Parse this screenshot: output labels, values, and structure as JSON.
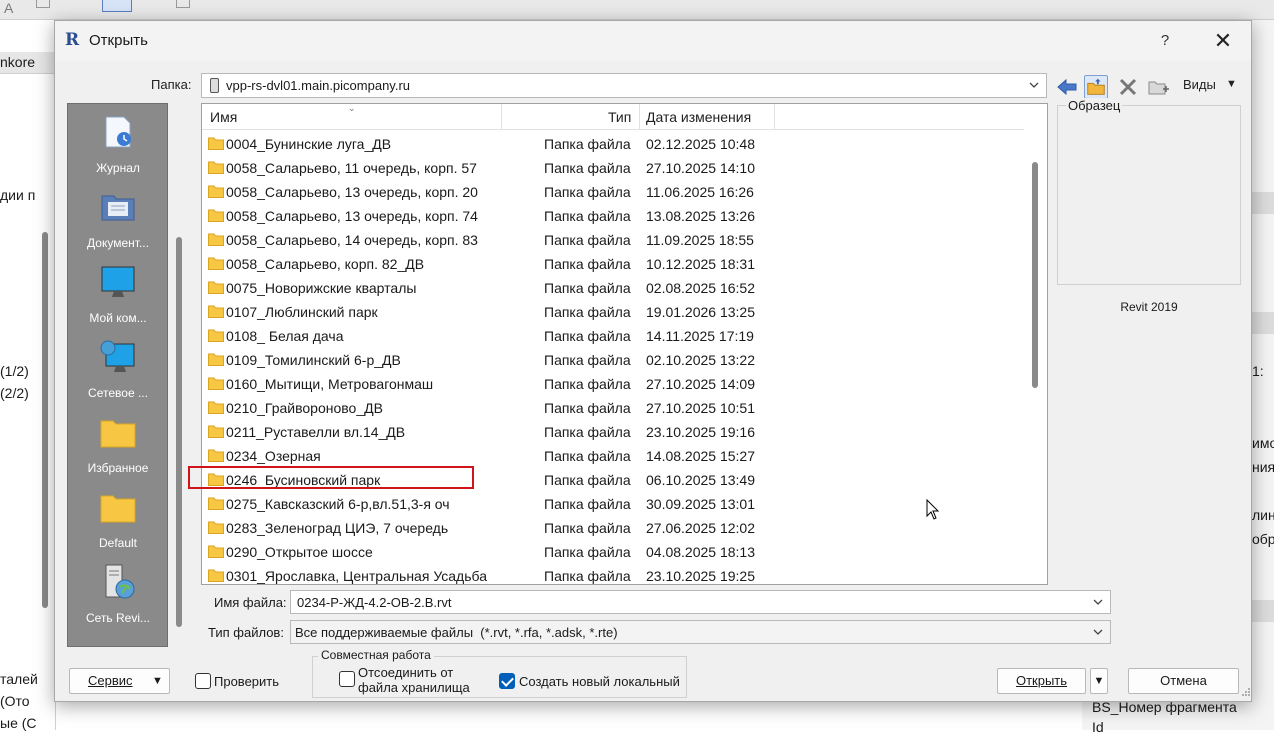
{
  "background": {
    "left_header": "nkore",
    "left_texts": [
      "дии п",
      "(1/2)",
      "(2/2)",
      "талей",
      "(Ото",
      "ые (С"
    ],
    "right_texts": [
      "1:",
      "имо",
      "ния",
      "лин",
      "обра"
    ],
    "bottom_field": "BS_Номер фрагмента",
    "bottom_field2": "Id"
  },
  "dialog": {
    "title": "Открыть",
    "help": "?",
    "close": "✕",
    "folder_label": "Папка:",
    "folder_path": "vpp-rs-dvl01.main.picompany.ru",
    "views_label": "Виды",
    "places": [
      "Журнал",
      "Документ...",
      "Мой ком...",
      "Сетевое ...",
      "Избранное",
      "Default",
      "Сеть Revi..."
    ],
    "columns": {
      "name": "Имя",
      "type": "Тип",
      "date": "Дата изменения"
    },
    "files": [
      {
        "name": "0004_Бунинские луга_ДВ",
        "type": "Папка файла",
        "date": "02.12.2025 10:48"
      },
      {
        "name": "0058_Саларьево, 11 очередь, корп. 57",
        "type": "Папка файла",
        "date": "27.10.2025 14:10"
      },
      {
        "name": "0058_Саларьево, 13 очередь, корп. 20",
        "type": "Папка файла",
        "date": "11.06.2025 16:26"
      },
      {
        "name": "0058_Саларьево, 13 очередь, корп. 74",
        "type": "Папка файла",
        "date": "13.08.2025 13:26"
      },
      {
        "name": "0058_Саларьево, 14 очередь, корп. 83",
        "type": "Папка файла",
        "date": "11.09.2025 18:55"
      },
      {
        "name": "0058_Саларьево, корп. 82_ДВ",
        "type": "Папка файла",
        "date": "10.12.2025 18:31"
      },
      {
        "name": "0075_Новорижские кварталы",
        "type": "Папка файла",
        "date": "02.08.2025 16:52"
      },
      {
        "name": "0107_Люблинский парк",
        "type": "Папка файла",
        "date": "19.01.2026 13:25"
      },
      {
        "name": "0108_ Белая дача",
        "type": "Папка файла",
        "date": "14.11.2025 17:19"
      },
      {
        "name": "0109_Томилинский 6-р_ДВ",
        "type": "Папка файла",
        "date": "02.10.2025 13:22"
      },
      {
        "name": "0160_Мытищи, Метровагонмаш",
        "type": "Папка файла",
        "date": "27.10.2025 14:09"
      },
      {
        "name": "0210_Грайвороново_ДВ",
        "type": "Папка файла",
        "date": "27.10.2025 10:51"
      },
      {
        "name": "0211_Руставелли вл.14_ДВ",
        "type": "Папка файла",
        "date": "23.10.2025 19:16"
      },
      {
        "name": "0234_Озерная",
        "type": "Папка файла",
        "date": "14.08.2025 15:27"
      },
      {
        "name": "0246_Бусиновский парк",
        "type": "Папка файла",
        "date": "06.10.2025 13:49"
      },
      {
        "name": "0275_Кавсказский 6-р,вл.51,3-я оч",
        "type": "Папка файла",
        "date": "30.09.2025 13:01"
      },
      {
        "name": "0283_Зеленоград ЦИЭ, 7 очередь",
        "type": "Папка файла",
        "date": "27.06.2025 12:02"
      },
      {
        "name": "0290_Открытое шоссе",
        "type": "Папка файла",
        "date": "04.08.2025 18:13"
      },
      {
        "name": "0301_Ярославка, Центральная Усадьба",
        "type": "Папка файла",
        "date": "23.10.2025 19:25"
      }
    ],
    "preview_label": "Образец",
    "preview_version": "Revit 2019",
    "filename_label": "Имя файла:",
    "filename_value": "0234-Р-ЖД-4.2-ОВ-2.В.rvt",
    "filetype_label": "Тип файлов:",
    "filetype_value": "Все поддерживаемые файлы  (*.rvt, *.rfa, *.adsk, *.rte)",
    "service_button": "Сервис",
    "verify_label": "Проверить",
    "collab_group": "Совместная работа",
    "detach_label_1": "Отсоединить от",
    "detach_label_2": "файла хранилища",
    "create_local_label": "Создать новый локальный",
    "open_button": "Открыть",
    "cancel_button": "Отмена"
  },
  "colors": {
    "accent": "#005fb8",
    "highlight": "#d0141b",
    "folder": "#f7c744",
    "places_bg": "#8a8a8a"
  }
}
